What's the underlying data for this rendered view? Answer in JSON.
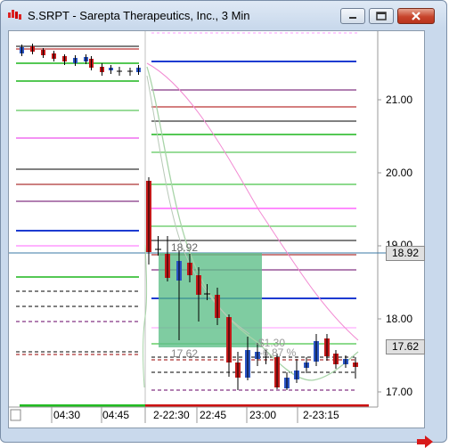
{
  "window": {
    "title": "S.SRPT - Sarepta Therapeutics, Inc., 3 Min",
    "icons": {
      "app": "chart-app-icon",
      "minimize": "minimize-icon",
      "maximize": "maximize-icon",
      "close": "close-icon"
    }
  },
  "price_axis": {
    "labels": [
      "21.00",
      "20.00",
      "19.00",
      "18.00",
      "17.00"
    ],
    "current_price_box": "17.62",
    "crosshair_price_box": "18.92"
  },
  "time_axis": {
    "labels": [
      "04:30",
      "04:45",
      "2-22:30",
      "22:45",
      "23:00",
      "2-23:15"
    ]
  },
  "annotations": {
    "entry_label": "18.92",
    "stop_label": "17.62",
    "change_label": "-$1.30",
    "pct_label": "-6.87 %"
  },
  "nav": {
    "scroll_right": "arrow-right-icon"
  },
  "colors": {
    "up_candle": "#2a55c4",
    "down_candle": "#c41a1a",
    "highlight_box": "#5fbf8a"
  }
}
